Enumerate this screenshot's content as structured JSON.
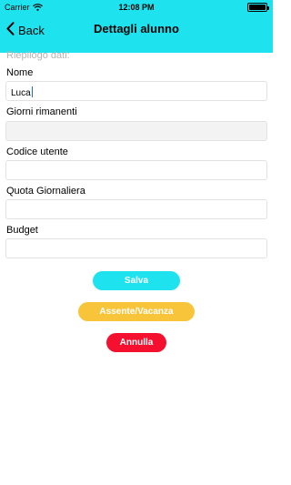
{
  "status_bar": {
    "carrier": "Carrier",
    "time": "12:08 PM"
  },
  "nav": {
    "back_label": "Back",
    "title": "Dettagli alunno"
  },
  "form": {
    "section_title": "Riepilogo dati:",
    "fields": [
      {
        "label": "Nome",
        "value": "Luca"
      },
      {
        "label": "Giorni rimanenti",
        "value": ""
      },
      {
        "label": "Codice utente",
        "value": ""
      },
      {
        "label": "Quota Giornaliera",
        "value": ""
      },
      {
        "label": "Budget",
        "value": ""
      }
    ]
  },
  "buttons": {
    "save": {
      "label": "Salva",
      "color": "#1ee3ee"
    },
    "absent": {
      "label": "Assente/Vacanza",
      "color": "#f8c43a"
    },
    "cancel": {
      "label": "Annulla",
      "color": "#f4102e"
    }
  },
  "colors": {
    "header": "#1ee3ee"
  }
}
